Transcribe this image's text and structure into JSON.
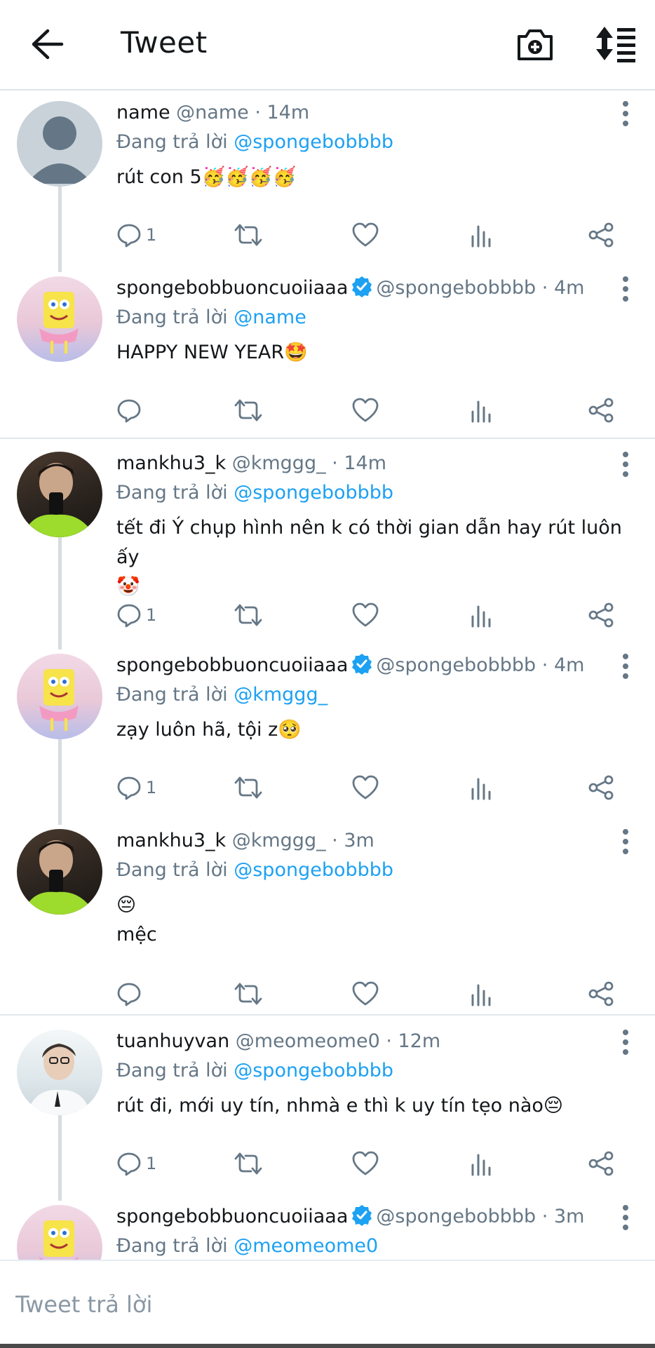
{
  "header": {
    "title": "Tweet"
  },
  "tweets": [
    {
      "name": "name",
      "handle": "@name",
      "time": "14m",
      "verified": false,
      "reply_prefix": "Đang trả lời",
      "reply_to": "@spongebobbbb",
      "text": "rút con 5",
      "emoji": "🥳🥳🥳🥳",
      "reply_count": "1",
      "avatar": "default"
    },
    {
      "name": "spongebobbuoncuoiiaaa",
      "handle": "@spongebobbbb",
      "time": "4m",
      "verified": true,
      "reply_prefix": "Đang trả lời",
      "reply_to": "@name",
      "text": "HAPPY NEW YEAR",
      "emoji": "🤩",
      "reply_count": "",
      "avatar": "sponge"
    },
    {
      "name": "mankhu3_k",
      "handle": "@kmggg_",
      "time": "14m",
      "verified": false,
      "reply_prefix": "Đang trả lời",
      "reply_to": "@spongebobbbb",
      "text": "tết đi Ý chụp hình nên k có thời gian dẫn hay rút luôn ấy",
      "emoji": "🤡",
      "reply_count": "1",
      "avatar": "man"
    },
    {
      "name": "spongebobbuoncuoiiaaa",
      "handle": "@spongebobbbb",
      "time": "4m",
      "verified": true,
      "reply_prefix": "Đang trả lời",
      "reply_to": "@kmggg_",
      "text": "zạy luôn hã, tội z",
      "emoji": "🥺",
      "reply_count": "1",
      "avatar": "sponge"
    },
    {
      "name": "mankhu3_k",
      "handle": "@kmggg_",
      "time": "3m",
      "verified": false,
      "reply_prefix": "Đang trả lời",
      "reply_to": "@spongebobbbb",
      "text": "mệc",
      "emoji": "😔",
      "reply_count": "",
      "avatar": "man"
    },
    {
      "name": "tuanhuyvan",
      "handle": "@meomeome0",
      "time": "12m",
      "verified": false,
      "reply_prefix": "Đang trả lời",
      "reply_to": "@spongebobbbb",
      "text": "rút đi, mới uy tín, nhmà e thì k uy tín tẹo nào",
      "emoji": "😔",
      "reply_count": "1",
      "avatar": "tuan"
    },
    {
      "name": "spongebobbuoncuoiiaaa",
      "handle": "@spongebobbbb",
      "time": "3m",
      "verified": true,
      "reply_prefix": "Đang trả lời",
      "reply_to": "@meomeome0",
      "text": "",
      "emoji": "",
      "reply_count": "",
      "avatar": "sponge"
    }
  ],
  "composer": {
    "placeholder": "Tweet trả lời"
  },
  "colors": {
    "accent": "#1da1f2",
    "muted": "#657786",
    "text": "#14171a"
  },
  "icons": [
    "back-arrow-icon",
    "camera-plus-icon",
    "sort-icon",
    "more-vertical-icon",
    "reply-icon",
    "retweet-icon",
    "like-icon",
    "views-icon",
    "share-icon",
    "verified-icon"
  ]
}
